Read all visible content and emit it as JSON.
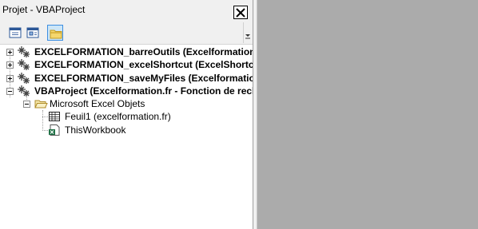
{
  "window": {
    "title": "Projet - VBAProject"
  },
  "toolbar": {
    "buttons": [
      {
        "name": "view-code",
        "icon": "view-code-icon"
      },
      {
        "name": "view-object",
        "icon": "view-object-icon"
      },
      {
        "name": "toggle-folders",
        "icon": "folder-icon",
        "pressed": true
      }
    ]
  },
  "tree": {
    "projects": [
      {
        "label": "EXCELFORMATION_barreOutils (Excelformation.fr",
        "expanded": false
      },
      {
        "label": "EXCELFORMATION_excelShortcut (ExcelShortcut",
        "expanded": false
      },
      {
        "label": "EXCELFORMATION_saveMyFiles (Excelformation.",
        "expanded": false
      },
      {
        "label": "VBAProject (Excelformation.fr - Fonction de rech",
        "expanded": true
      }
    ],
    "folder": {
      "label": "Microsoft Excel Objets",
      "expanded": true
    },
    "objects": [
      {
        "label": "Feuil1 (excelformation.fr)",
        "icon": "worksheet-icon"
      },
      {
        "label": "ThisWorkbook",
        "icon": "workbook-icon"
      }
    ]
  },
  "colors": {
    "editor_bg": "#ababab",
    "panel_bg": "#ffffff",
    "chrome_bg": "#f0f0f0",
    "accent": "#3d8ee0"
  }
}
